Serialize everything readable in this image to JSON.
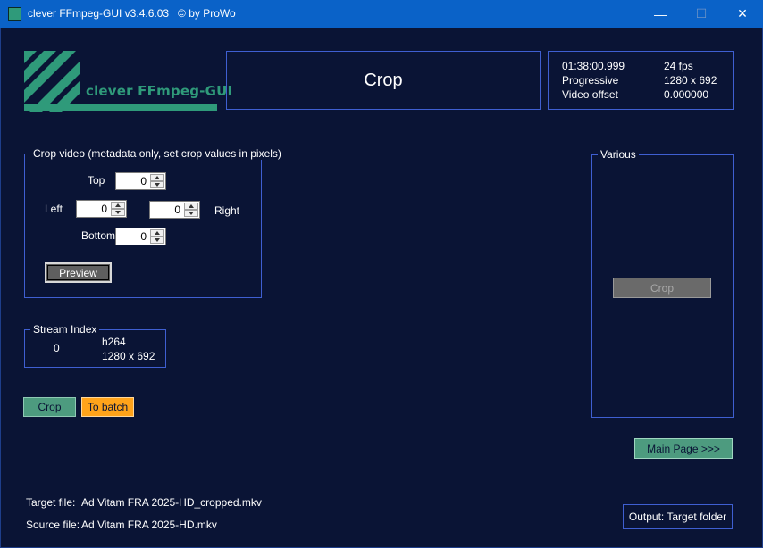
{
  "window": {
    "title": "clever FFmpeg-GUI v3.4.6.03   © by ProWo",
    "minimize_glyph": "—",
    "maximize_glyph": "☐",
    "close_glyph": "✕"
  },
  "logo": {
    "text": "clever FFmpeg-GUI",
    "color": "#2f9a7a"
  },
  "header": {
    "title": "Crop"
  },
  "info": {
    "duration": "01:38:00.999",
    "fps": "24 fps",
    "scan": "Progressive",
    "resolution": "1280 x 692",
    "offset_label": "Video offset",
    "offset_value": "0.000000"
  },
  "crop_group": {
    "label": "Crop video (metadata only, set crop values in pixels)",
    "top_label": "Top",
    "top_value": "0",
    "left_label": "Left",
    "left_value": "0",
    "right_label": "Right",
    "right_value": "0",
    "bottom_label": "Bottom",
    "bottom_value": "0",
    "preview_label": "Preview"
  },
  "stream_group": {
    "label": "Stream Index",
    "index": "0",
    "codec": "h264",
    "resolution": "1280 x 692"
  },
  "various_group": {
    "label": "Various",
    "crop_button": "Crop"
  },
  "actions": {
    "crop": "Crop",
    "to_batch": "To batch",
    "main_page": "Main Page >>>",
    "output": "Output: Target folder"
  },
  "files": {
    "target_label": "Target file:",
    "target_value": "Ad Vitam FRA 2025-HD_cropped.mkv",
    "source_label": "Source file:",
    "source_value": "Ad Vitam FRA 2025-HD.mkv"
  },
  "colors": {
    "background": "#0a1435",
    "titlebar": "#0a62c8",
    "border": "#3f5fd1",
    "accent_green": "#4d9b7f",
    "accent_orange": "#ffa31a"
  }
}
